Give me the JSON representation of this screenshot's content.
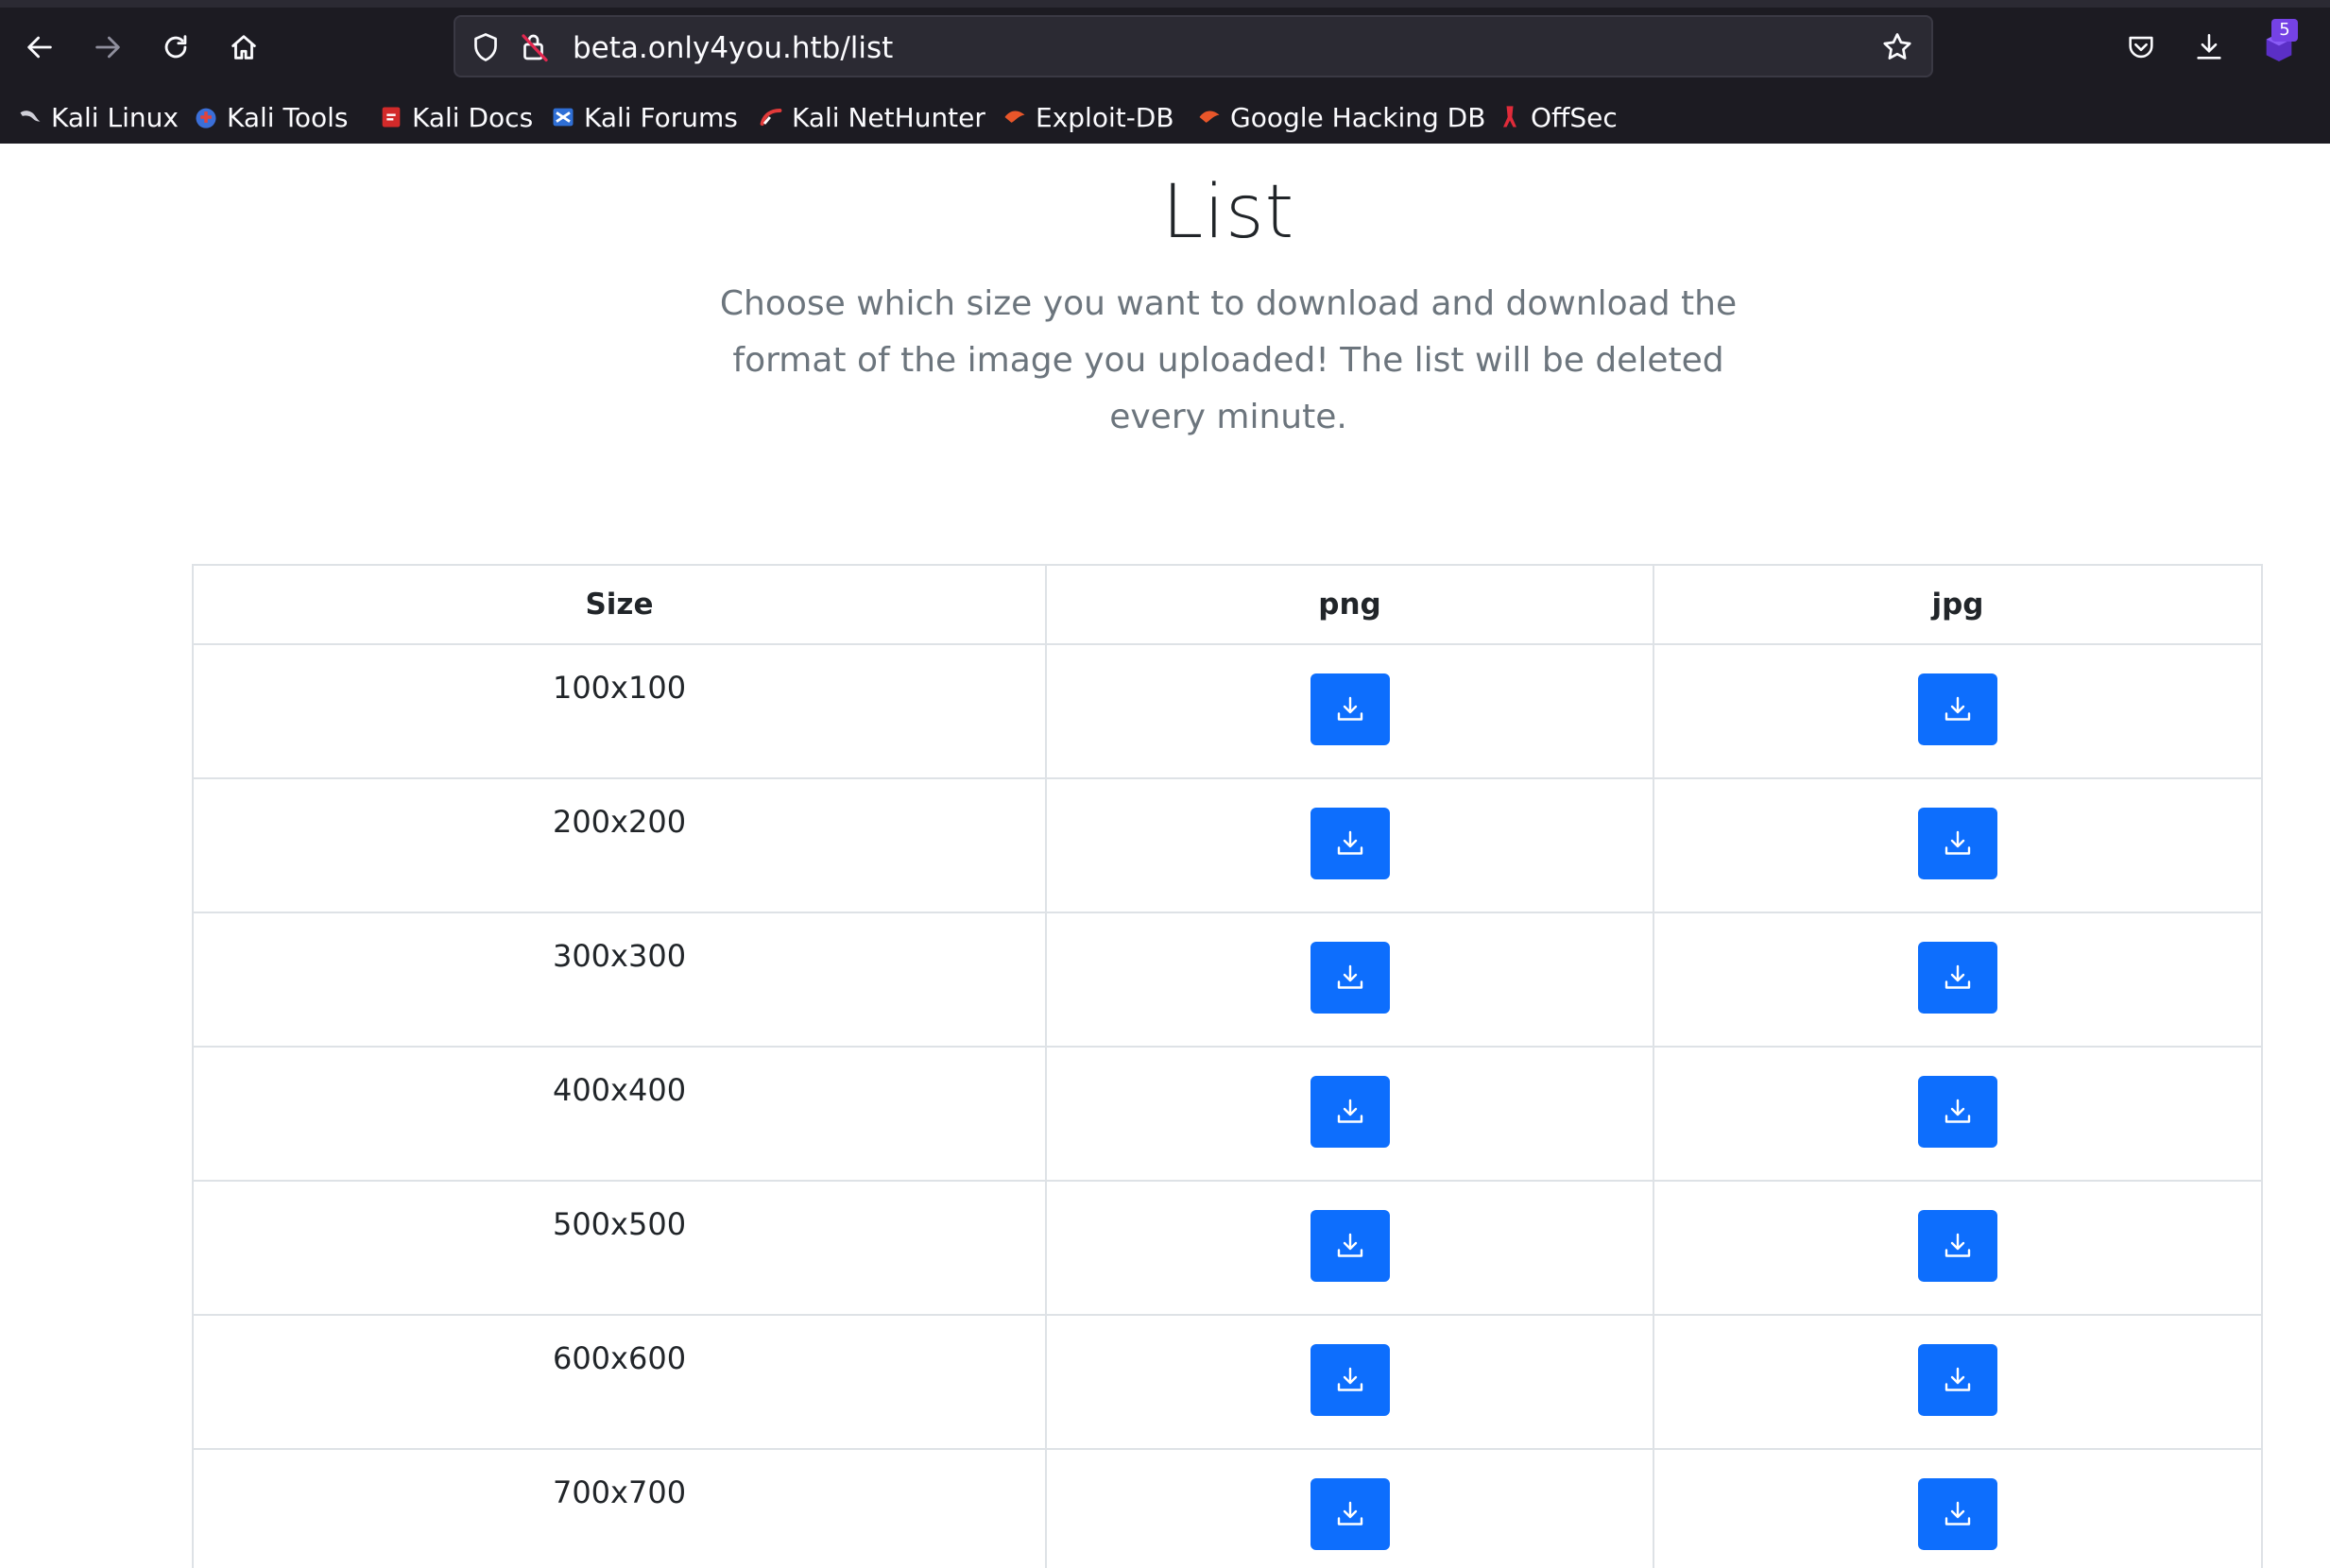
{
  "browser": {
    "url": "beta.only4you.htb/list",
    "extension_badge": "5",
    "bookmarks": [
      {
        "label": "Kali Linux",
        "icon": "kali-dragon-icon"
      },
      {
        "label": "Kali Tools",
        "icon": "kali-tools-icon"
      },
      {
        "label": "Kali Docs",
        "icon": "kali-docs-icon"
      },
      {
        "label": "Kali Forums",
        "icon": "kali-forums-icon"
      },
      {
        "label": "Kali NetHunter",
        "icon": "kali-nethunter-icon"
      },
      {
        "label": "Exploit-DB",
        "icon": "exploit-db-icon"
      },
      {
        "label": "Google Hacking DB",
        "icon": "ghdb-icon"
      },
      {
        "label": "OffSec",
        "icon": "offsec-icon"
      }
    ]
  },
  "page": {
    "title": "List",
    "subtitle": "Choose which size you want to download and download the format of the image you uploaded! The list will be deleted every minute."
  },
  "table": {
    "headers": [
      "Size",
      "png",
      "jpg"
    ],
    "rows": [
      "100x100",
      "200x200",
      "300x300",
      "400x400",
      "500x500",
      "600x600",
      "700x700"
    ]
  },
  "colors": {
    "chrome_bg": "#1c1b22",
    "button_primary": "#0d6efd",
    "text_muted": "#6c757d"
  }
}
